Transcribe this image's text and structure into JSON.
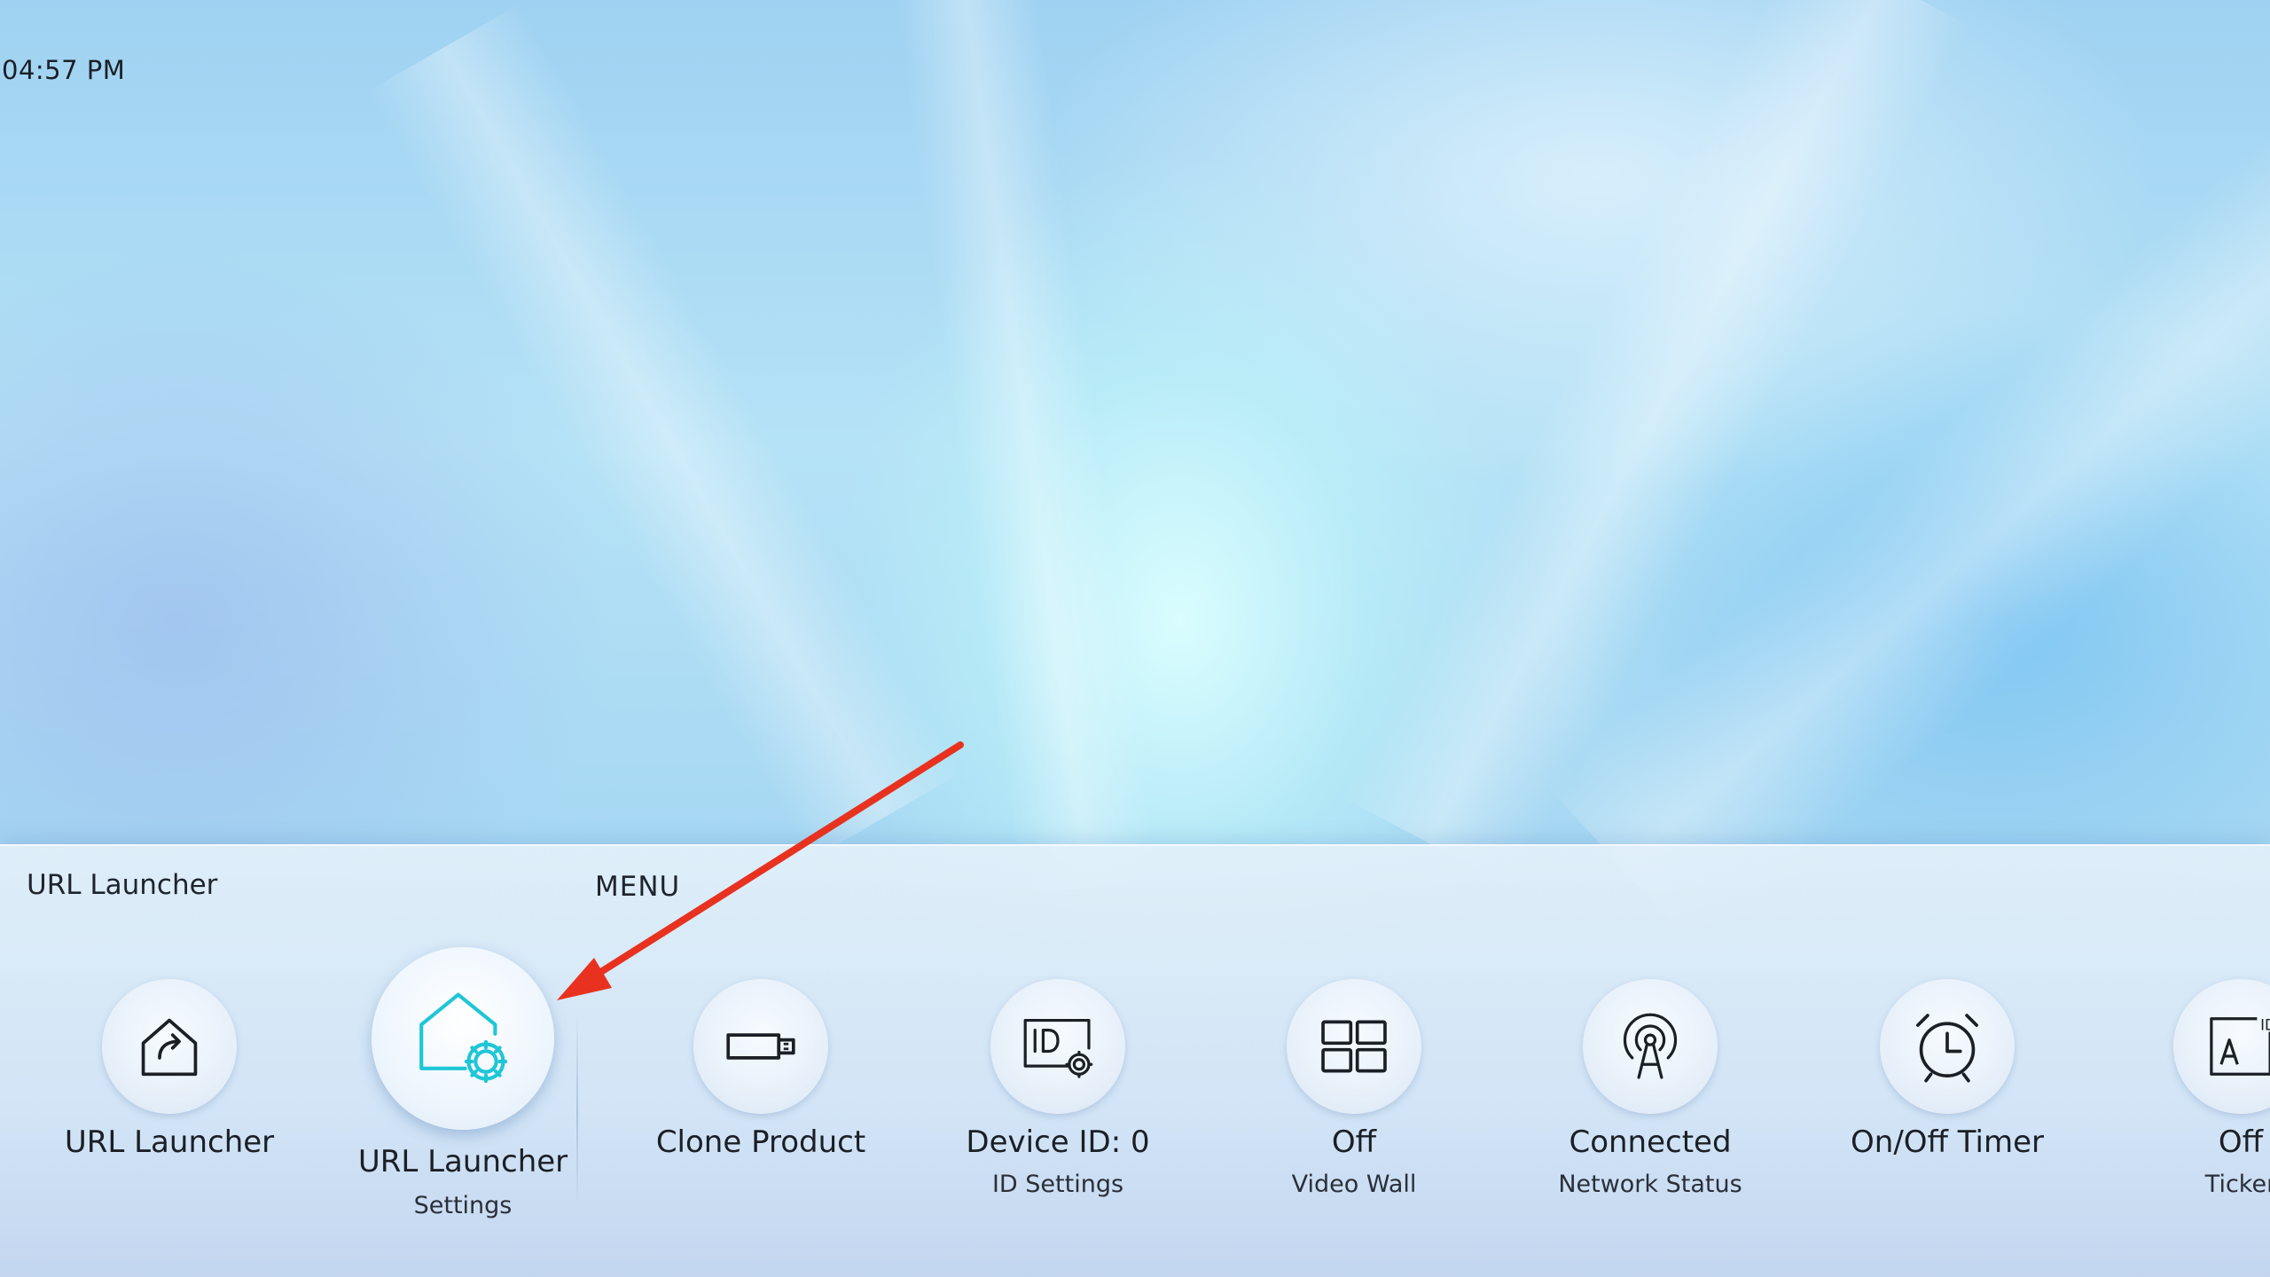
{
  "status_bar": {
    "time": "04:57 PM"
  },
  "menu_bar": {
    "section_label": "URL Launcher",
    "menu_label": "MENU",
    "tiles": [
      {
        "main": "URL Launcher",
        "sub": "",
        "icon": "url-launcher-icon"
      },
      {
        "main": "URL Launcher",
        "sub": "Settings",
        "icon": "url-launcher-settings-icon"
      },
      {
        "main": "Clone Product",
        "sub": "",
        "icon": "usb-drive-icon"
      },
      {
        "main": "Device ID: 0",
        "sub": "ID Settings",
        "icon": "id-settings-icon"
      },
      {
        "main": "Off",
        "sub": "Video Wall",
        "icon": "video-wall-grid-icon"
      },
      {
        "main": "Connected",
        "sub": "Network Status",
        "icon": "network-antenna-icon"
      },
      {
        "main": "On/Off Timer",
        "sub": "",
        "icon": "alarm-clock-icon"
      },
      {
        "main": "Off",
        "sub": "Ticker",
        "icon": "ticker-icon"
      }
    ]
  },
  "colors": {
    "accent": "#1fc6d6",
    "annotation_arrow": "#e8321f",
    "text": "#1b1f26"
  }
}
